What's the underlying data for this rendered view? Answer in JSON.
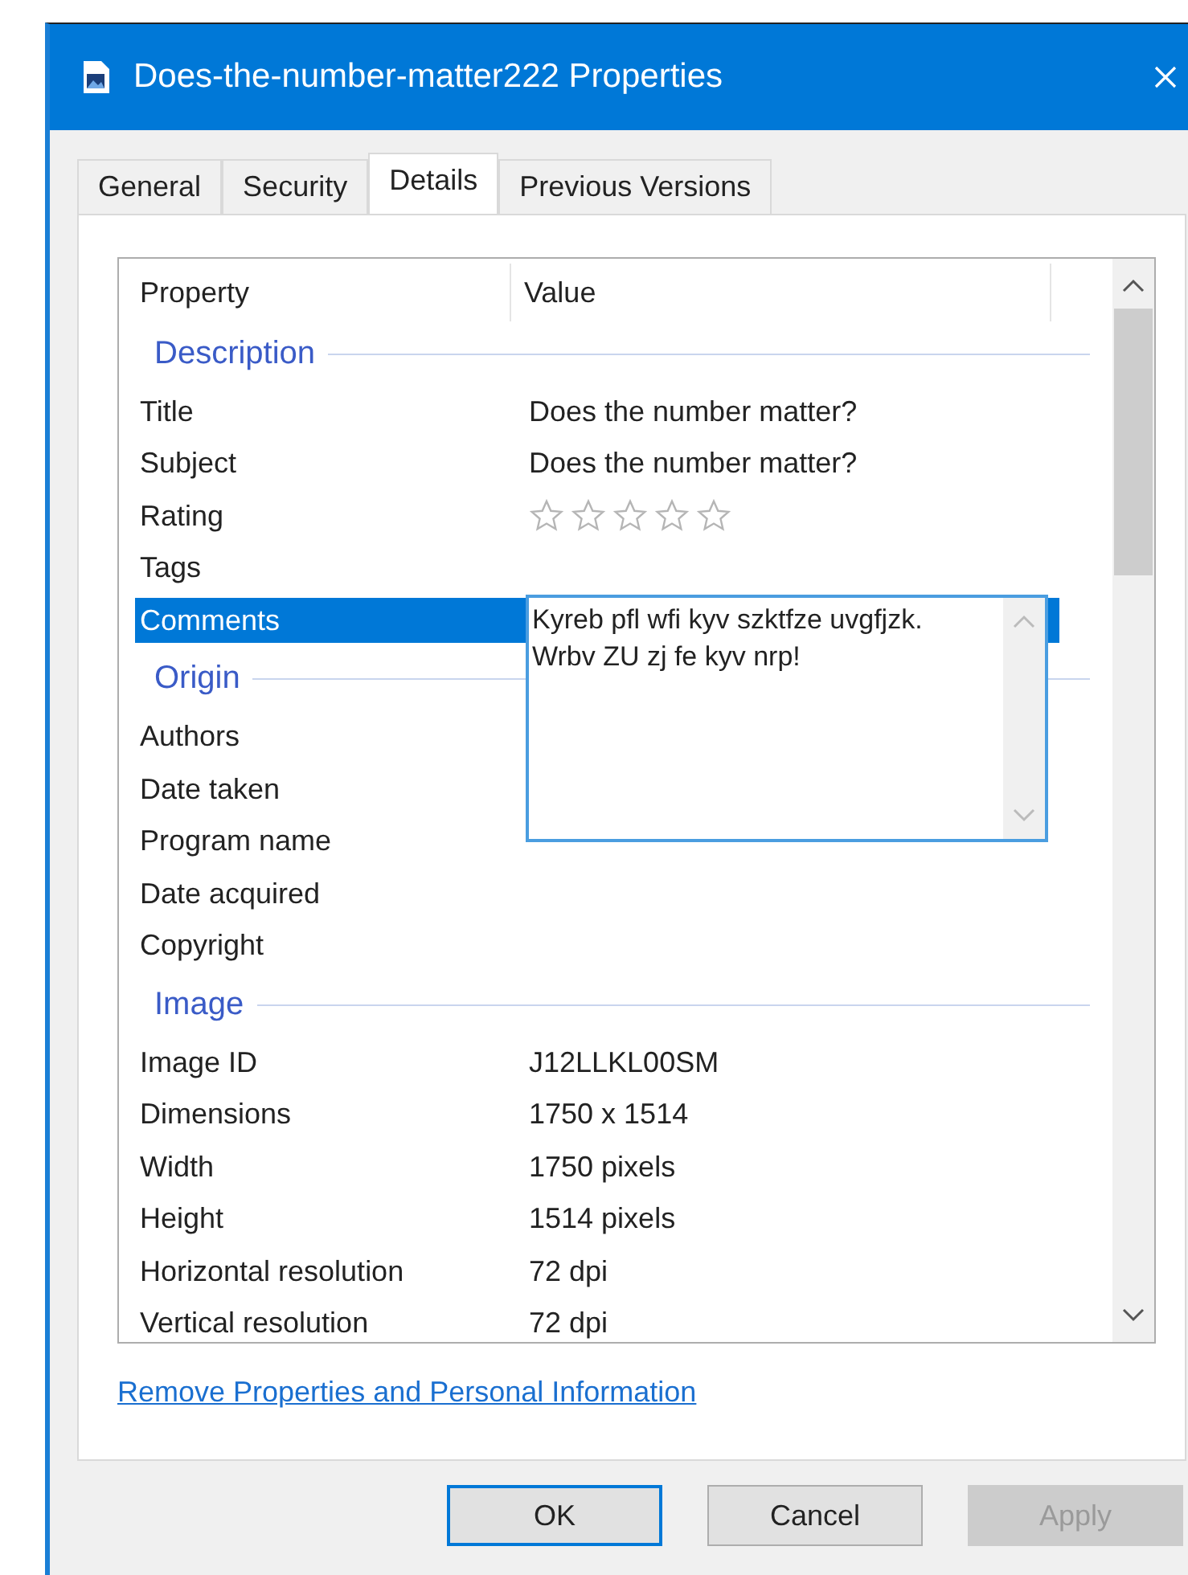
{
  "window": {
    "title": "Does-the-number-matter222 Properties"
  },
  "tabs": [
    {
      "label": "General",
      "selected": false
    },
    {
      "label": "Security",
      "selected": false
    },
    {
      "label": "Details",
      "selected": true
    },
    {
      "label": "Previous Versions",
      "selected": false
    }
  ],
  "columns": [
    "Property",
    "Value"
  ],
  "rows": [
    {
      "kind": "group",
      "label": "Description"
    },
    {
      "kind": "property",
      "name": "Title",
      "value": "Does the number matter?",
      "selected": false
    },
    {
      "kind": "property",
      "name": "Subject",
      "value": "Does the number matter?",
      "selected": false
    },
    {
      "kind": "rating",
      "name": "Rating",
      "stars": 0,
      "selected": false
    },
    {
      "kind": "property",
      "name": "Tags",
      "selected": false
    },
    {
      "kind": "editing",
      "name": "Comments",
      "value": "Kyreb pfl wfi kyv szktfze uvgfjzk.\nWrbv ZU zj fe kyv nrp!",
      "selected": true
    },
    {
      "kind": "group",
      "label": "Origin"
    },
    {
      "kind": "property",
      "name": "Authors",
      "selected": false
    },
    {
      "kind": "property",
      "name": "Date taken",
      "selected": false
    },
    {
      "kind": "property",
      "name": "Program name",
      "selected": false
    },
    {
      "kind": "property",
      "name": "Date acquired",
      "selected": false
    },
    {
      "kind": "property",
      "name": "Copyright",
      "selected": false
    },
    {
      "kind": "group",
      "label": "Image"
    },
    {
      "kind": "property",
      "name": "Image ID",
      "value": "J12LLKL00SM",
      "selected": false
    },
    {
      "kind": "property",
      "name": "Dimensions",
      "value": "1750 x 1514",
      "selected": false
    },
    {
      "kind": "property",
      "name": "Width",
      "value": "1750 pixels",
      "selected": false
    },
    {
      "kind": "property",
      "name": "Height",
      "value": "1514 pixels",
      "selected": false
    },
    {
      "kind": "property",
      "name": "Horizontal resolution",
      "value": "72 dpi",
      "selected": false
    },
    {
      "kind": "property",
      "name": "Vertical resolution",
      "value": "72 dpi",
      "selected": false
    }
  ],
  "link": "Remove Properties and Personal Information",
  "buttons": [
    {
      "label": "OK",
      "default": true,
      "disabled": false
    },
    {
      "label": "Cancel",
      "default": false,
      "disabled": false
    },
    {
      "label": "Apply",
      "default": false,
      "disabled": true
    }
  ]
}
